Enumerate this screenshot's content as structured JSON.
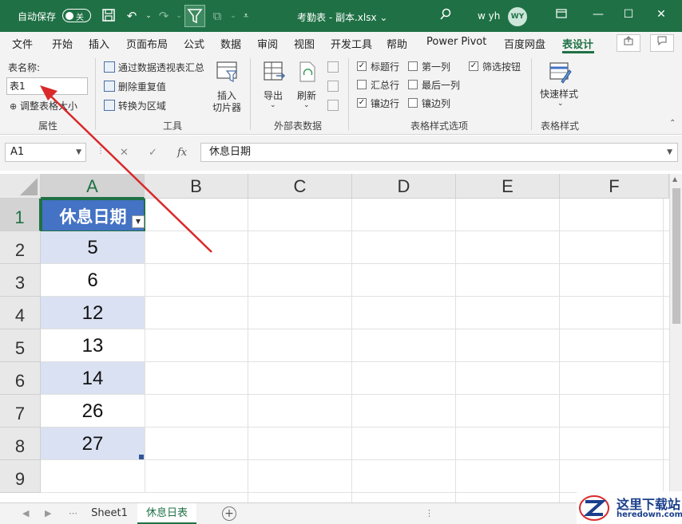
{
  "titlebar": {
    "autosave_label": "自动保存",
    "autosave_state": "关",
    "doc_title": "考勤表 - 副本.xlsx ⌄",
    "user_name": "w yh",
    "user_initials": "WY"
  },
  "tabs": [
    "文件",
    "开始",
    "插入",
    "页面布局",
    "公式",
    "数据",
    "审阅",
    "视图",
    "开发工具",
    "帮助",
    "Power Pivot",
    "百度网盘",
    "表设计"
  ],
  "active_tab": "表设计",
  "ribbon": {
    "properties": {
      "table_name_label": "表名称:",
      "table_name_value": "表1",
      "resize_label": "调整表格大小",
      "group_title": "属性"
    },
    "tools": {
      "pivot_label": "通过数据透视表汇总",
      "dedupe_label": "删除重复值",
      "convert_label": "转换为区域",
      "slicer_line1": "插入",
      "slicer_line2": "切片器",
      "group_title": "工具"
    },
    "external": {
      "export_label": "导出",
      "refresh_label": "刷新",
      "group_title": "外部表数据"
    },
    "style_options": {
      "header_row": "标题行",
      "first_column": "第一列",
      "filter_button": "筛选按钮",
      "total_row": "汇总行",
      "last_column": "最后一列",
      "banded_rows": "镶边行",
      "banded_columns": "镶边列",
      "group_title": "表格样式选项"
    },
    "styles": {
      "quick_styles_label": "快速样式",
      "group_title": "表格样式"
    }
  },
  "formula_bar": {
    "name_box": "A1",
    "fx": "fx",
    "content": "休息日期"
  },
  "columns": [
    "A",
    "B",
    "C",
    "D",
    "E",
    "F"
  ],
  "rows": [
    "1",
    "2",
    "3",
    "4",
    "5",
    "6",
    "7",
    "8",
    "9"
  ],
  "table": {
    "header": "休息日期",
    "values": [
      "5",
      "6",
      "12",
      "13",
      "14",
      "26",
      "27"
    ]
  },
  "sheets": [
    "Sheet1",
    "休息日表"
  ],
  "active_sheet": "休息日表",
  "watermark": {
    "title": "这里下载站",
    "url": "heredown.com"
  },
  "colors": {
    "excel_green": "#1f7145",
    "table_header": "#4472c4",
    "band": "#d9e1f2",
    "annotation_arrow": "#d9292b"
  }
}
